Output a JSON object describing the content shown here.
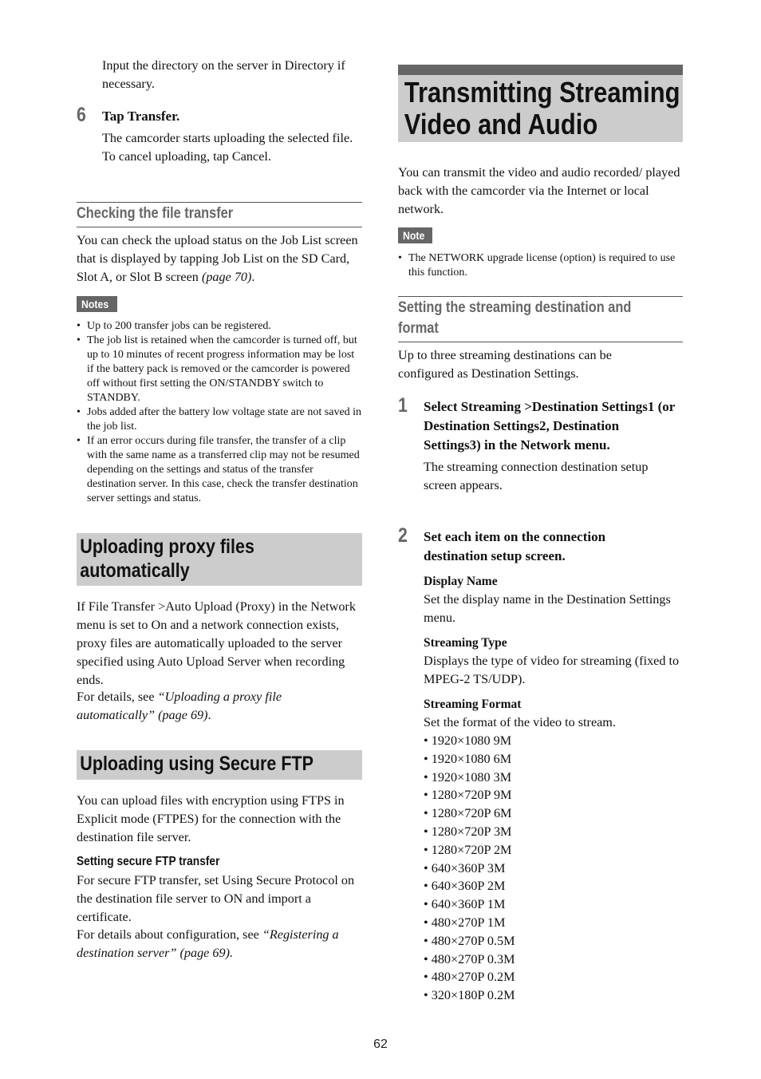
{
  "left": {
    "intro_text": "Input the directory on the server in Directory if necessary.",
    "step6": {
      "number": "6",
      "title": "Tap Transfer.",
      "line1": "The camcorder starts uploading the selected file.",
      "line2": "To cancel uploading, tap Cancel."
    },
    "checking": {
      "heading": "Checking the file transfer",
      "body_pre": "You can check the upload status on the Job List screen that is displayed by tapping Job List on the SD Card, Slot A, or Slot B screen ",
      "body_ref": "(page 70)",
      "body_post": ".",
      "notes_label": "Notes",
      "notes": [
        "Up to 200 transfer jobs can be registered.",
        "The job list is retained when the camcorder is turned off, but up to 10 minutes of recent progress information may be lost if the battery pack is removed or the camcorder is powered off without first setting the ON/STANDBY switch to STANDBY.",
        "Jobs added after the battery low voltage state are not saved in the job list.",
        "If an error occurs during file transfer, the transfer of a clip with the same name as a transferred clip may not be resumed depending on the settings and status of the transfer destination server. In this case, check the transfer destination server settings and status."
      ]
    },
    "proxy": {
      "heading_line1": "Uploading proxy files",
      "heading_line2": "automatically",
      "body": "If File Transfer >Auto Upload (Proxy) in the Network menu is set to On and a network connection exists, proxy files are automatically uploaded to the server specified using Auto Upload Server when recording ends.",
      "details_pre": "For details, see ",
      "details_ref": "“Uploading a proxy file automatically” (page 69)",
      "details_post": "."
    },
    "sftp": {
      "heading": "Uploading using Secure FTP",
      "body": "You can upload files with encryption using FTPS in Explicit mode (FTPES) for the connection with the destination file server.",
      "subheading": "Setting secure FTP transfer",
      "sub_body": "For secure FTP transfer, set Using Secure Protocol on the destination file server to ON and import a certificate.",
      "details_pre": "For details about configuration, see ",
      "details_ref": "“Registering a destination server” (page 69).",
      "details_post": ""
    }
  },
  "right": {
    "title_line1": "Transmitting Streaming",
    "title_line2": "Video and Audio",
    "intro": "You can transmit the video and audio recorded/ played back with the camcorder via the Internet or local network.",
    "note_label": "Note",
    "note": "The NETWORK upgrade license (option) is required to use this function.",
    "setting": {
      "heading_line1": "Setting the streaming destination and",
      "heading_line2": "format",
      "body": "Up to three streaming destinations can be configured as Destination Settings."
    },
    "step1": {
      "number": "1",
      "title": "Select Streaming >Destination Settings1 (or Destination Settings2, Destination Settings3) in the Network menu.",
      "body": "The streaming connection destination setup screen appears."
    },
    "step2": {
      "number": "2",
      "title": "Set each item on the connection destination setup screen.",
      "items": [
        {
          "term": "Display Name",
          "desc": "Set the display name in the Destination Settings menu."
        },
        {
          "term": "Streaming Type",
          "desc": "Displays the type of video for streaming (fixed to MPEG-2 TS/UDP)."
        },
        {
          "term": "Streaming Format",
          "desc": "Set the format of the video to stream."
        }
      ],
      "formats": [
        "1920×1080 9M",
        "1920×1080 6M",
        "1920×1080 3M",
        "1280×720P 9M",
        "1280×720P 6M",
        "1280×720P 3M",
        "1280×720P 2M",
        "640×360P 3M",
        "640×360P 2M",
        "640×360P 1M",
        "480×270P 1M",
        "480×270P 0.5M",
        "480×270P 0.3M",
        "480×270P 0.2M",
        "320×180P 0.2M"
      ]
    }
  },
  "page_number": "62"
}
